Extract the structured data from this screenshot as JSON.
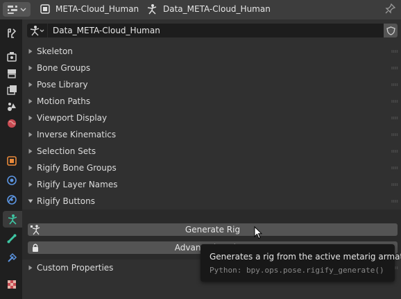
{
  "header": {
    "object_name": "META-Cloud_Human",
    "data_name": "Data_META-Cloud_Human"
  },
  "datablock": {
    "name": "Data_META-Cloud_Human"
  },
  "panels": [
    {
      "label": "Skeleton",
      "expanded": false
    },
    {
      "label": "Bone Groups",
      "expanded": false
    },
    {
      "label": "Pose Library",
      "expanded": false
    },
    {
      "label": "Motion Paths",
      "expanded": false
    },
    {
      "label": "Viewport Display",
      "expanded": false
    },
    {
      "label": "Inverse Kinematics",
      "expanded": false
    },
    {
      "label": "Selection Sets",
      "expanded": false
    },
    {
      "label": "Rigify Bone Groups",
      "expanded": false
    },
    {
      "label": "Rigify Layer Names",
      "expanded": false
    },
    {
      "label": "Rigify Buttons",
      "expanded": true
    },
    {
      "label": "Custom Properties",
      "expanded": false
    }
  ],
  "rigify": {
    "generate_label": "Generate Rig",
    "advanced_label": "Advanced Options"
  },
  "tooltip": {
    "title": "Generates a rig from the active metarig armature.",
    "python": "Python: bpy.ops.pose.rigify_generate()"
  },
  "colors": {
    "accent_armature": "#3ec6a3",
    "button": "#545454",
    "panel_bg": "#303030"
  }
}
